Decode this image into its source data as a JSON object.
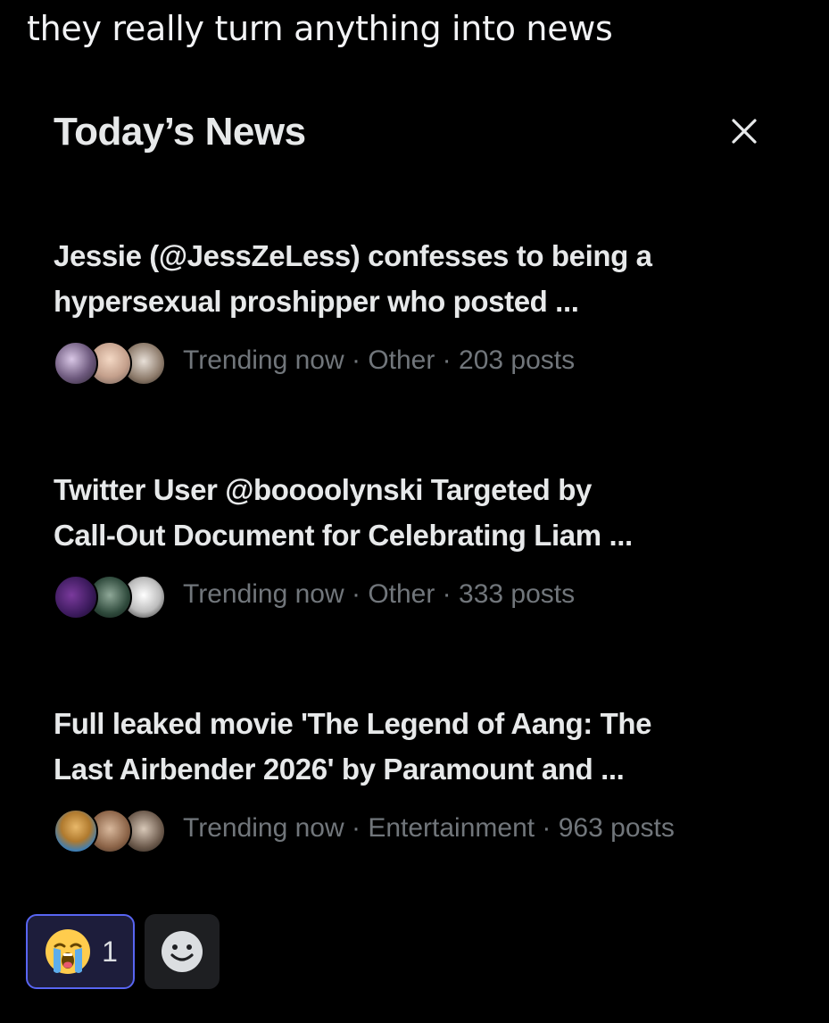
{
  "message": {
    "text": "they really turn anything into news"
  },
  "panel": {
    "title": "Today’s News",
    "close_icon": "close-icon",
    "items": [
      {
        "headline_line1": "Jessie (@JessZeLess) confesses to being a",
        "headline_line2": "hypersexual proshipper who posted ...",
        "meta": "Trending now · Other · 203 posts"
      },
      {
        "headline_line1": "Twitter User @boooolynski Targeted by",
        "headline_line2": "Call-Out Document for Celebrating Liam ...",
        "meta": "Trending now · Other · 333 posts"
      },
      {
        "headline_line1": "Full leaked movie 'The Legend of Aang: The",
        "headline_line2": "Last Airbender 2026' by Paramount and ...",
        "meta": "Trending now · Entertainment · 963 posts"
      }
    ]
  },
  "reactions": {
    "items": [
      {
        "emoji": "😭",
        "icon": "loudly-crying-face-icon",
        "count": "1",
        "selected": true
      }
    ],
    "add_reaction_icon": "smiley-add-reaction-icon"
  },
  "colors": {
    "background": "#000000",
    "headline": "#e7e9ea",
    "meta": "#71767b",
    "reaction_selected_border": "#5865f2",
    "reaction_selected_bg": "#1d1d3b"
  }
}
